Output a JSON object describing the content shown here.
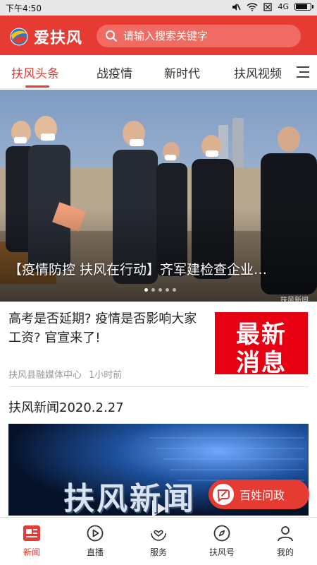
{
  "status_bar": {
    "time": "下午4:50",
    "network": "4G"
  },
  "header": {
    "app_name": "爱扶风",
    "logo_icon": "globe-logo-icon",
    "search_placeholder": "请输入搜索关键字",
    "search_icon": "search-icon"
  },
  "tabs": [
    {
      "label": "扶风头条",
      "active": true
    },
    {
      "label": "战疫情",
      "active": false
    },
    {
      "label": "新时代",
      "active": false
    },
    {
      "label": "扶风视频",
      "active": false
    }
  ],
  "tabs_menu_icon": "menu-icon",
  "banner": {
    "caption": "【疫情防控 扶风在行动】齐军建检查企业…",
    "watermark": "扶风新闻",
    "slide_count": 5,
    "active_slide": 1
  },
  "news": [
    {
      "title": "高考是否延期? 疫情是否影响大家工资? 官宣来了!",
      "source": "扶风县融媒体中心",
      "time": "1小时前",
      "thumb_text": [
        "最新",
        "消息"
      ]
    },
    {
      "title": "扶风新闻2020.2.27",
      "video_text": "扶风新闻"
    }
  ],
  "fab": {
    "label": "百姓问政",
    "icon": "edit-bubble-icon"
  },
  "bottom_nav": [
    {
      "label": "新闻",
      "icon": "news-icon",
      "active": true
    },
    {
      "label": "直播",
      "icon": "play-circle-icon",
      "active": false
    },
    {
      "label": "服务",
      "icon": "heart-hands-icon",
      "active": false
    },
    {
      "label": "扶风号",
      "icon": "compass-icon",
      "active": false
    },
    {
      "label": "我的",
      "icon": "person-icon",
      "active": false
    }
  ],
  "colors": {
    "brand_red": "#e53b33",
    "thumb_red": "#e60012"
  }
}
